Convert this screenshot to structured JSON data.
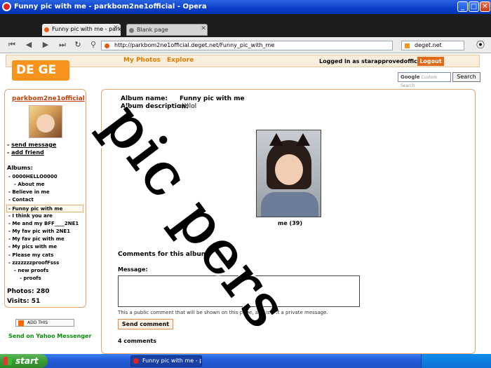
{
  "window": {
    "title": "Funny pic with me - parkbom2ne1official - Opera",
    "min_glyph": "_",
    "max_glyph": "□",
    "close_glyph": "✕"
  },
  "tabs": [
    {
      "label": "Funny pic with me - park...",
      "active": true,
      "close_glyph": "✕"
    },
    {
      "label": "Blank page",
      "active": false,
      "close_glyph": "✕"
    }
  ],
  "navbar": {
    "buttons": [
      "⏮",
      "◀",
      "▶",
      "⏭",
      "↻",
      "⚲"
    ],
    "url": "http://parkbom2ne1official.deget.net/Funny_pic_with_me",
    "search_engine_label": "deget.net"
  },
  "site": {
    "logo": "DE GE",
    "nav": [
      "My Photos",
      "Explore"
    ],
    "logged_in_text": "Logged in as starapprovedofficial.",
    "logout_label": "Logout",
    "search_placeholder": "Custom Search",
    "search_brand": "Google",
    "search_button": "Search"
  },
  "sidebar": {
    "username": "parkbom2ne1official",
    "links": [
      "send message",
      "add friend"
    ],
    "albums_heading": "Albums:",
    "albums": [
      {
        "label": "- 0000HELLO0000",
        "indent": 0,
        "selected": false
      },
      {
        "label": "- About me",
        "indent": 1,
        "selected": false
      },
      {
        "label": "- Believe in me",
        "indent": 0,
        "selected": false
      },
      {
        "label": "- Contact",
        "indent": 0,
        "selected": false
      },
      {
        "label": "- Funny pic with me",
        "indent": 0,
        "selected": true
      },
      {
        "label": "- I think you are",
        "indent": 0,
        "selected": false
      },
      {
        "label": "- Me and my BFF____2NE1",
        "indent": 0,
        "selected": false
      },
      {
        "label": "- My fav pic with 2NE1",
        "indent": 0,
        "selected": false
      },
      {
        "label": "- My fav pic with me",
        "indent": 0,
        "selected": false
      },
      {
        "label": "- My pics with me",
        "indent": 0,
        "selected": false
      },
      {
        "label": "- Please my cats",
        "indent": 0,
        "selected": false
      },
      {
        "label": "- zzzzzzzproofFsss",
        "indent": 0,
        "selected": false
      },
      {
        "label": "- new proofs",
        "indent": 1,
        "selected": false
      },
      {
        "label": "- proofs",
        "indent": 2,
        "selected": false
      }
    ],
    "photos_label": "Photos:",
    "photos_count": "280",
    "visits_label": "Visits:",
    "visits_count": "51",
    "addthis_label": "ADD THIS",
    "yahoo_label": "Send on Yahoo Messenger"
  },
  "album": {
    "name_label": "Album name:",
    "name_value": "Funny pic with me",
    "description_label": "Album description:",
    "description_value": ":)))lol",
    "photo_caption": "me (39)"
  },
  "comments": {
    "heading": "Comments for this album:",
    "message_label": "Message:",
    "hint": "This a public comment that will be shown on this page, and is not a private message.",
    "send_label": "Send comment",
    "count_text": "4 comments"
  },
  "overlay": {
    "watermark": "pic pers"
  },
  "taskbar": {
    "start_label": "start",
    "task_label": "Funny pic with me - p..."
  }
}
